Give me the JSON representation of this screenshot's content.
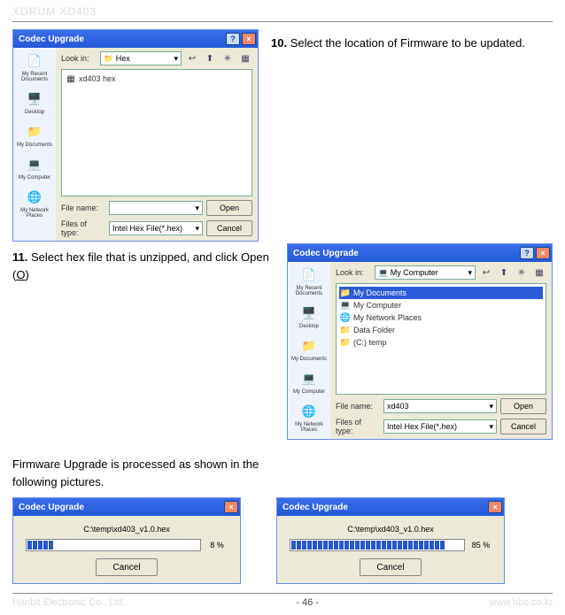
{
  "doc_title": "XDRUM XD403",
  "step10": "Select the location of Firmware to be updated.",
  "step11_a": "Select hex file that is unzipped, and click Open (",
  "step11_b": "O",
  "step11_c": ")",
  "midtext": "Firmware Upgrade is processed as shown in the following pictures.",
  "footer_left": "Hanbit Electronic Co., Ltd.",
  "footer_page": "- 46 -",
  "footer_right": "www.hbe.co.kr",
  "dialog1": {
    "title": "Codec Upgrade",
    "lookin_label": "Look in:",
    "lookin_value": "Hex",
    "files": [
      "xd403 hex"
    ],
    "filename_label": "File name:",
    "filename_value": "",
    "filetype_label": "Files of type:",
    "filetype_value": "Intel Hex File(*.hex)",
    "open": "Open",
    "cancel": "Cancel",
    "sidebar": [
      "My Recent Documents",
      "Desktop",
      "My Documents",
      "My Computer",
      "My Network Places"
    ]
  },
  "dialog2": {
    "title": "Codec Upgrade",
    "lookin_label": "Look in:",
    "lookin_value": "My Computer",
    "files": [
      "My Documents",
      "My Computer",
      "My Network Places",
      "Data Folder",
      "(C:) temp"
    ],
    "selected_index": 0,
    "filename_label": "File name:",
    "filename_value": "xd403",
    "filetype_label": "Files of type:",
    "filetype_value": "Intel Hex File(*.hex)",
    "open": "Open",
    "cancel": "Cancel",
    "sidebar": [
      "My Recent Documents",
      "Desktop",
      "My Documents",
      "My Computer",
      "My Network Places"
    ]
  },
  "progress1": {
    "title": "Codec Upgrade",
    "path": "C:\\temp\\xd403_v1.0.hex",
    "percent": "8 %",
    "segments": 5,
    "total": 32,
    "cancel": "Cancel"
  },
  "progress2": {
    "title": "Codec Upgrade",
    "path": "C:\\temp\\xd403_v1.0.hex",
    "percent": "85 %",
    "segments": 29,
    "total": 32,
    "cancel": "Cancel"
  }
}
